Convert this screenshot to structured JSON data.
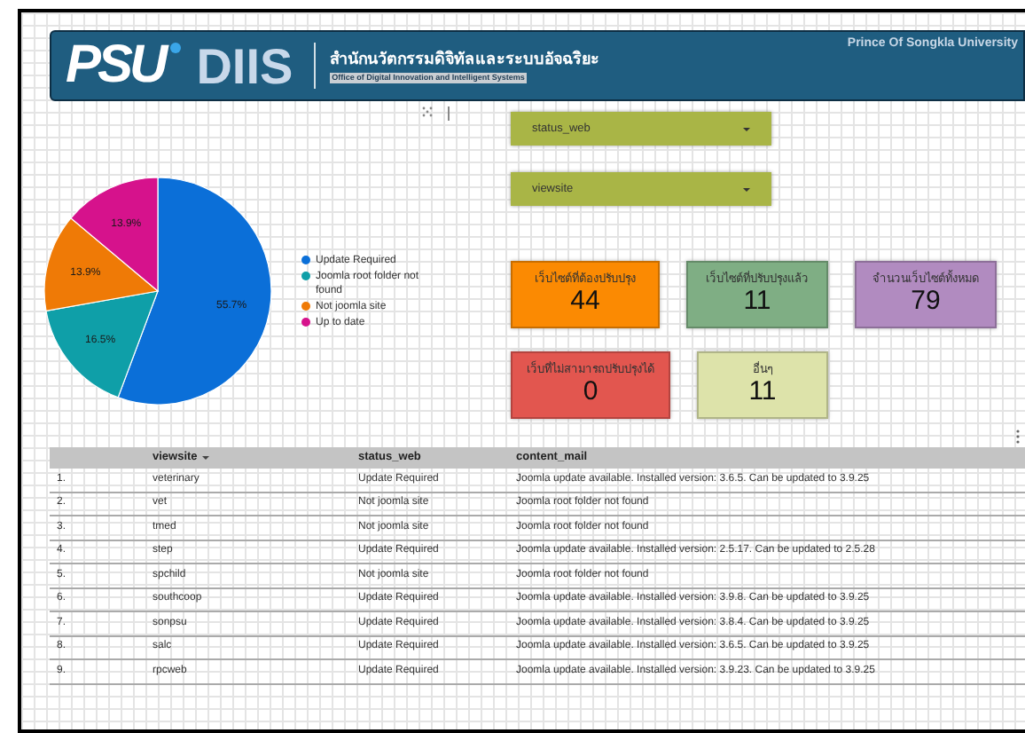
{
  "header": {
    "logo_left": "PSU",
    "logo_right": "DIIS",
    "org_name_th": "สำนักนวัตกรรมดิจิทัลและระบบอัจฉริยะ",
    "org_name_en": "Office of Digital Innovation and Intelligent Systems",
    "university": "Prince Of Songkla University"
  },
  "chart": {
    "chart_data": {
      "type": "pie",
      "categories": [
        "Update Required",
        "Joomla root folder not found",
        "Not joomla site",
        "Up to date"
      ],
      "series": [
        {
          "values": [
            55.7,
            16.5,
            13.9,
            13.9
          ]
        }
      ],
      "data_labels": "value_labels",
      "value_labels": [
        "55.7%",
        "16.5%",
        "13.9%",
        "13.9%"
      ]
    },
    "slices": [
      {
        "color": "#0b6fd8"
      },
      {
        "color": "#0f9fa8"
      },
      {
        "color": "#ef7a06"
      },
      {
        "color": "#d6128c"
      }
    ]
  },
  "filters": [
    {
      "label": "status_web"
    },
    {
      "label": "viewsite"
    }
  ],
  "scorecards": [
    {
      "label": "เว็บไซต์ที่ต้องปรับปรุง",
      "value": "44",
      "color": "#fb8a02"
    },
    {
      "label": "เว็บไซต์ที่ปรับปรุงแล้ว",
      "value": "11",
      "color": "#7fae84"
    },
    {
      "label": "จำนวนเว็บไซต์ทั้งหมด",
      "value": "79",
      "color": "#b18bc0"
    },
    {
      "label": "เว็บที่ไม่สามารถปรับปรุงได้",
      "value": "0",
      "color": "#e2564f"
    },
    {
      "label": "อื่นๆ",
      "value": "11",
      "color": "#dde3aa"
    }
  ],
  "table": {
    "columns": [
      {
        "sorted": false
      },
      {
        "label": "viewsite",
        "sorted": true
      },
      {
        "label": "status_web",
        "sorted": false
      },
      {
        "label": "content_mail",
        "sorted": false
      }
    ],
    "rows": [
      [
        "1.",
        "veterinary",
        "Update Required",
        "Joomla update available. Installed version: 3.6.5. Can be updated to 3.9.25"
      ],
      [
        "2.",
        "vet",
        "Not joomla site",
        "Joomla root folder not found"
      ],
      [
        "3.",
        "tmed",
        "Not joomla site",
        "Joomla root folder not found"
      ],
      [
        "4.",
        "step",
        "Update Required",
        "Joomla update available. Installed version: 2.5.17. Can be updated to 2.5.28"
      ],
      [
        "5.",
        "spchild",
        "Not joomla site",
        "Joomla root folder not found"
      ],
      [
        "6.",
        "southcoop",
        "Update Required",
        "Joomla update available. Installed version: 3.9.8. Can be updated to 3.9.25"
      ],
      [
        "7.",
        "sonpsu",
        "Update Required",
        "Joomla update available. Installed version: 3.8.4. Can be updated to 3.9.25"
      ],
      [
        "8.",
        "salc",
        "Update Required",
        "Joomla update available. Installed version: 3.6.5. Can be updated to 3.9.25"
      ],
      [
        "9.",
        "rpcweb",
        "Update Required",
        "Joomla update available. Installed version: 3.9.23. Can be updated to 3.9.25"
      ]
    ]
  }
}
